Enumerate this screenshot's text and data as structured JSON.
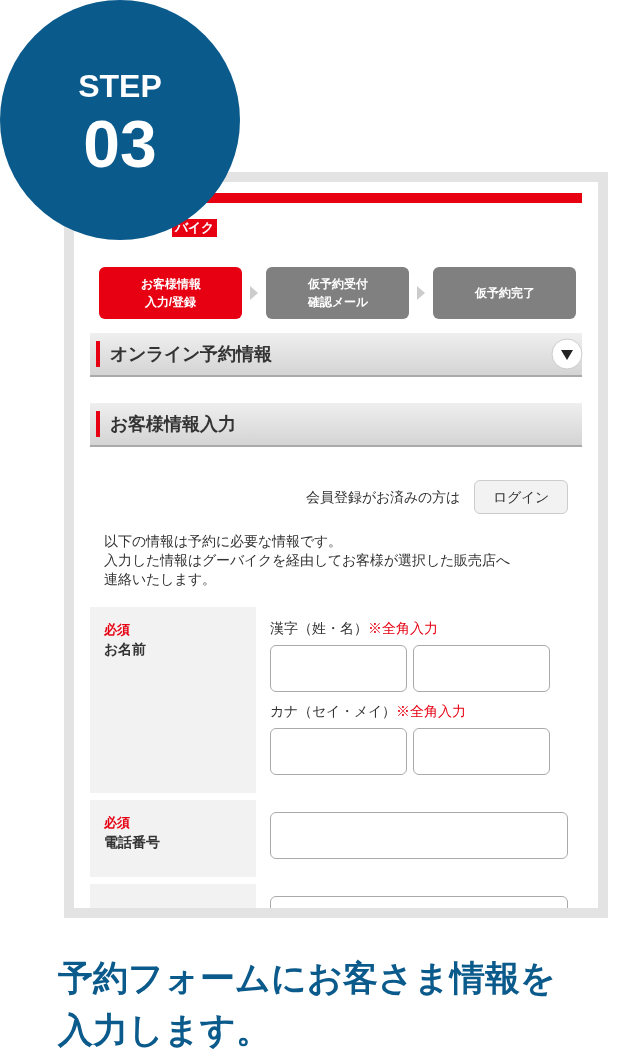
{
  "badge": {
    "label": "STEP",
    "number": "03"
  },
  "phone": {
    "logo_badge": "バイク",
    "steps": [
      {
        "lines": [
          "お客様情報",
          "入力/登録"
        ],
        "selected": true
      },
      {
        "lines": [
          "仮予約受付",
          "確認メール"
        ],
        "selected": false
      },
      {
        "lines": [
          "仮予約完了"
        ],
        "selected": false
      }
    ],
    "sections": [
      {
        "title": "オンライン予約情報",
        "expandable": true
      },
      {
        "title": "お客様情報入力",
        "expandable": false
      }
    ],
    "login": {
      "prompt": "会員登録がお済みの方は",
      "button": "ログイン"
    },
    "intro": [
      "以下の情報は予約に必要な情報です。",
      "入力した情報はグーバイクを経由してお客様が選択した販売店へ",
      "連絡いたします。"
    ],
    "form_rows": [
      {
        "required": "必須",
        "label": "お名前",
        "groups": [
          {
            "label": "漢字（姓・名）",
            "note": "※全角入力",
            "fields": [
              {
                "kind": "half"
              },
              {
                "kind": "half"
              }
            ]
          },
          {
            "label": "カナ（セイ・メイ）",
            "note": "※全角入力",
            "fields": [
              {
                "kind": "half"
              },
              {
                "kind": "half"
              }
            ]
          }
        ]
      },
      {
        "required": "必須",
        "label": "電話番号",
        "groups": [
          {
            "fields": [
              {
                "kind": "full"
              }
            ]
          }
        ]
      },
      {
        "groups": [
          {
            "fields": [
              {
                "kind": "full"
              }
            ]
          }
        ]
      }
    ]
  },
  "caption": [
    "予約フォームにお客さま情報を",
    "入力します。"
  ]
}
